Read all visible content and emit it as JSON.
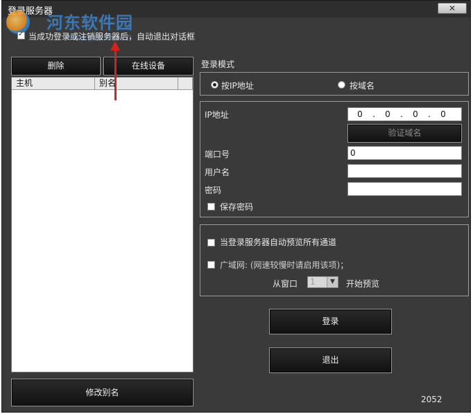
{
  "window": {
    "title": "登录服务器",
    "close_glyph": "✕"
  },
  "watermark": {
    "text": "河东软件园",
    "url": "www.pc0359.cn"
  },
  "auto_exit": {
    "label": "当成功登录或注销服务器后，自动退出对话框",
    "checked": true
  },
  "left": {
    "delete_label": "删除",
    "online_label": "在线设备",
    "columns": [
      "主机",
      "别名"
    ],
    "rows": [],
    "rename_label": "修改别名"
  },
  "login_mode": {
    "label": "登录模式",
    "options": [
      {
        "label": "按IP地址",
        "selected": true
      },
      {
        "label": "按域名",
        "selected": false
      }
    ]
  },
  "fields": {
    "ip_label": "IP地址",
    "ip_value": [
      "0",
      "0",
      "0",
      "0"
    ],
    "ip_dot": ".",
    "verify_label": "验证域名",
    "port_label": "端口号",
    "port_value": "0",
    "username_label": "用户名",
    "username_value": "",
    "password_label": "密码",
    "password_value": "",
    "save_password_label": "保存密码",
    "save_password_checked": false
  },
  "preview": {
    "auto_preview_label": "当登录服务器自动预览所有通道",
    "wan_label": "广域网: (网速较慢时请启用该项)；",
    "from_window_label": "从窗口",
    "window_value": "1",
    "start_preview_label": "开始预览"
  },
  "actions": {
    "login_label": "登录",
    "exit_label": "退出"
  },
  "footer": {
    "code": "2052"
  },
  "colors": {
    "background": "#3a3a3a",
    "arrow": "#d92020",
    "input_bg": "#ffffff"
  }
}
